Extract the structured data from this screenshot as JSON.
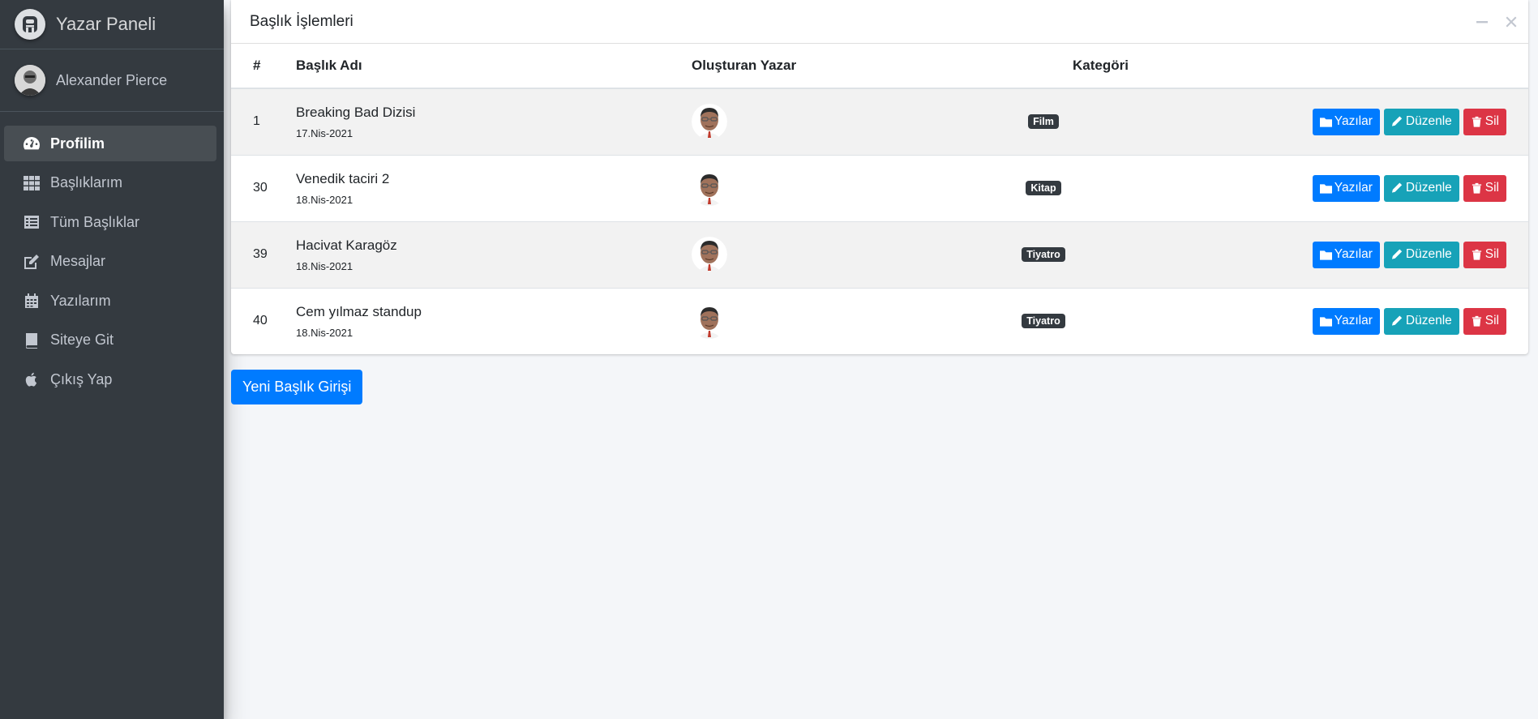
{
  "brand": {
    "name": "Yazar Paneli",
    "icon": "brand-logo-icon"
  },
  "user": {
    "name": "Alexander Pierce",
    "avatar": "user-avatar"
  },
  "sidebar": {
    "items": [
      {
        "label": "Profilim",
        "icon": "dashboard-icon",
        "active": true
      },
      {
        "label": "Başlıklarım",
        "icon": "grid-icon"
      },
      {
        "label": "Tüm Başlıklar",
        "icon": "list-icon"
      },
      {
        "label": "Mesajlar",
        "icon": "edit-icon"
      },
      {
        "label": "Yazılarım",
        "icon": "calendar-icon"
      },
      {
        "label": "Siteye Git",
        "icon": "book-icon"
      },
      {
        "label": "Çıkış Yap",
        "icon": "apple-icon"
      }
    ]
  },
  "card": {
    "title": "Başlık İşlemleri",
    "columns": [
      "#",
      "Başlık Adı",
      "Oluşturan Yazar",
      "Kategöri",
      ""
    ],
    "rows": [
      {
        "id": "1",
        "title": "Breaking Bad Dizisi",
        "date": "17.Nis-2021",
        "category": "Film"
      },
      {
        "id": "30",
        "title": "Venedik taciri 2",
        "date": "18.Nis-2021",
        "category": "Kitap"
      },
      {
        "id": "39",
        "title": "Hacivat Karagöz",
        "date": "18.Nis-2021",
        "category": "Tiyatro"
      },
      {
        "id": "40",
        "title": "Cem yılmaz standup",
        "date": "18.Nis-2021",
        "category": "Tiyatro"
      }
    ],
    "actions": {
      "posts": "Yazılar",
      "edit": "Düzenle",
      "delete": "Sil"
    }
  },
  "new_button": "Yeni Başlık Girişi",
  "colors": {
    "sidebar": "#343a40",
    "primary": "#007bff",
    "info": "#17a2b8",
    "danger": "#dc3545",
    "badge": "#343a40"
  }
}
